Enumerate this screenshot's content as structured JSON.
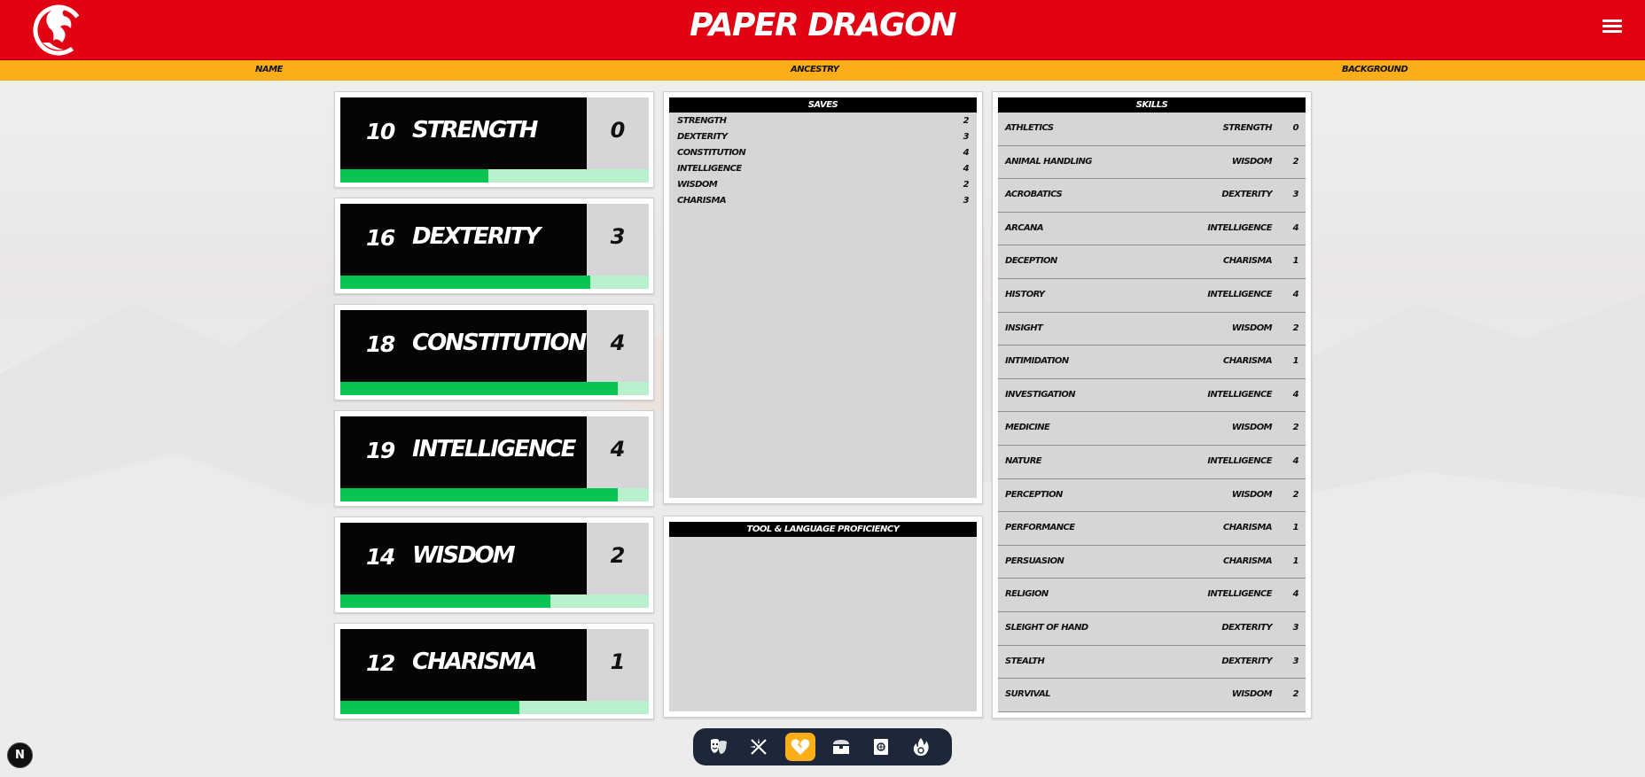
{
  "header": {
    "title": "PAPER DRAGON",
    "logo_icon": "dragon-logo-icon",
    "menu_icon": "hamburger-menu-icon",
    "brand_color": "#e10313",
    "accent_color": "#fbae17"
  },
  "infobar": {
    "name_label": "NAME",
    "ancestry_label": "ANCESTRY",
    "background_label": "BACKGROUND"
  },
  "abilities": [
    {
      "score": "10",
      "name": "STRENGTH",
      "mod": "0",
      "fill_pct": 48
    },
    {
      "score": "16",
      "name": "DEXTERITY",
      "mod": "3",
      "fill_pct": 81
    },
    {
      "score": "18",
      "name": "CONSTITUTION",
      "mod": "4",
      "fill_pct": 90
    },
    {
      "score": "19",
      "name": "INTELLIGENCE",
      "mod": "4",
      "fill_pct": 90
    },
    {
      "score": "14",
      "name": "WISDOM",
      "mod": "2",
      "fill_pct": 68
    },
    {
      "score": "12",
      "name": "CHARISMA",
      "mod": "1",
      "fill_pct": 58
    }
  ],
  "saves": {
    "title": "SAVES",
    "rows": [
      {
        "name": "STRENGTH",
        "value": "2"
      },
      {
        "name": "DEXTERITY",
        "value": "3"
      },
      {
        "name": "CONSTITUTION",
        "value": "4"
      },
      {
        "name": "INTELLIGENCE",
        "value": "4"
      },
      {
        "name": "WISDOM",
        "value": "2"
      },
      {
        "name": "CHARISMA",
        "value": "3"
      }
    ]
  },
  "tools": {
    "title": "TOOL & LANGUAGE PROFICIENCY"
  },
  "skills": {
    "title": "SKILLS",
    "rows": [
      {
        "name": "ATHLETICS",
        "ability": "STRENGTH",
        "value": "0"
      },
      {
        "name": "ANIMAL HANDLING",
        "ability": "WISDOM",
        "value": "2"
      },
      {
        "name": "ACROBATICS",
        "ability": "DEXTERITY",
        "value": "3"
      },
      {
        "name": "ARCANA",
        "ability": "INTELLIGENCE",
        "value": "4"
      },
      {
        "name": "DECEPTION",
        "ability": "CHARISMA",
        "value": "1"
      },
      {
        "name": "HISTORY",
        "ability": "INTELLIGENCE",
        "value": "4"
      },
      {
        "name": "INSIGHT",
        "ability": "WISDOM",
        "value": "2"
      },
      {
        "name": "INTIMIDATION",
        "ability": "CHARISMA",
        "value": "1"
      },
      {
        "name": "INVESTIGATION",
        "ability": "INTELLIGENCE",
        "value": "4"
      },
      {
        "name": "MEDICINE",
        "ability": "WISDOM",
        "value": "2"
      },
      {
        "name": "NATURE",
        "ability": "INTELLIGENCE",
        "value": "4"
      },
      {
        "name": "PERCEPTION",
        "ability": "WISDOM",
        "value": "2"
      },
      {
        "name": "PERFORMANCE",
        "ability": "CHARISMA",
        "value": "1"
      },
      {
        "name": "PERSUASION",
        "ability": "CHARISMA",
        "value": "1"
      },
      {
        "name": "RELIGION",
        "ability": "INTELLIGENCE",
        "value": "4"
      },
      {
        "name": "SLEIGHT OF HAND",
        "ability": "DEXTERITY",
        "value": "3"
      },
      {
        "name": "STEALTH",
        "ability": "DEXTERITY",
        "value": "3"
      },
      {
        "name": "SURVIVAL",
        "ability": "WISDOM",
        "value": "2"
      }
    ]
  },
  "bottom_nav": {
    "items": [
      {
        "icon": "masks-icon",
        "active": false
      },
      {
        "icon": "crossed-weapons-icon",
        "active": false
      },
      {
        "icon": "broken-heart-icon",
        "active": true
      },
      {
        "icon": "treasure-chest-icon",
        "active": false
      },
      {
        "icon": "spellbook-icon",
        "active": false
      },
      {
        "icon": "fire-spell-icon",
        "active": false
      }
    ]
  },
  "dev_badge": {
    "label": "N",
    "icon": "nextjs-badge-icon"
  }
}
